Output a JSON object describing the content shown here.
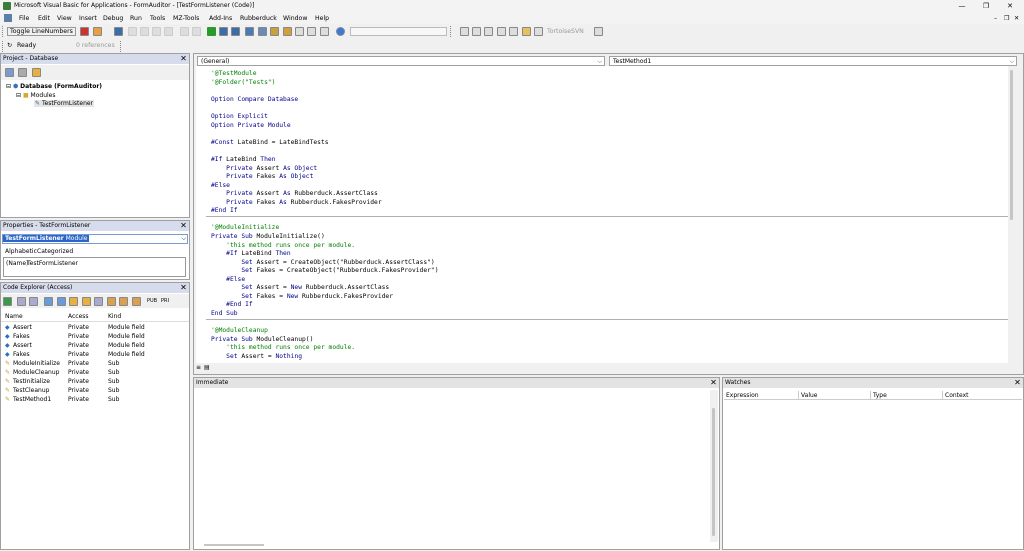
{
  "window": {
    "title": "Microsoft Visual Basic for Applications - FormAuditor - [TestFormListener (Code)]"
  },
  "menu": [
    "File",
    "Edit",
    "View",
    "Insert",
    "Debug",
    "Run",
    "Tools",
    "MZ-Tools",
    "Add-Ins",
    "Rubberduck",
    "Window",
    "Help"
  ],
  "toolbar": {
    "toggle_line_numbers": "Toggle LineNumbers",
    "tortoise": "TortoiseSVN",
    "status": "Ready",
    "references": "0 references"
  },
  "project": {
    "title": "Project - Database",
    "root": "Database (FormAuditor)",
    "folder": "Modules",
    "module": "TestFormListener"
  },
  "properties": {
    "title": "Properties - TestFormListener",
    "object": "TestFormListener",
    "object_type": "Module",
    "tab_alpha": "Alphabetic",
    "tab_cat": "Categorized",
    "prop_name": "(Name)",
    "prop_value": "TestFormListener"
  },
  "explorer": {
    "title": "Code Explorer (Access)",
    "col_name": "Name",
    "col_access": "Access",
    "col_kind": "Kind",
    "rows": [
      {
        "name": "Assert",
        "access": "Private",
        "kind": "Module field"
      },
      {
        "name": "Fakes",
        "access": "Private",
        "kind": "Module field"
      },
      {
        "name": "Assert",
        "access": "Private",
        "kind": "Module field"
      },
      {
        "name": "Fakes",
        "access": "Private",
        "kind": "Module field"
      },
      {
        "name": "ModuleInitialize",
        "access": "Private",
        "kind": "Sub"
      },
      {
        "name": "ModuleCleanup",
        "access": "Private",
        "kind": "Sub"
      },
      {
        "name": "TestInitialize",
        "access": "Private",
        "kind": "Sub"
      },
      {
        "name": "TestCleanup",
        "access": "Private",
        "kind": "Sub"
      },
      {
        "name": "TestMethod1",
        "access": "Private",
        "kind": "Sub"
      }
    ]
  },
  "code": {
    "object_combo": "(General)",
    "proc_combo": "TestMethod1"
  },
  "immediate": {
    "title": "Immediate"
  },
  "watches": {
    "title": "Watches",
    "col_expression": "Expression",
    "col_value": "Value",
    "col_type": "Type",
    "col_context": "Context"
  }
}
